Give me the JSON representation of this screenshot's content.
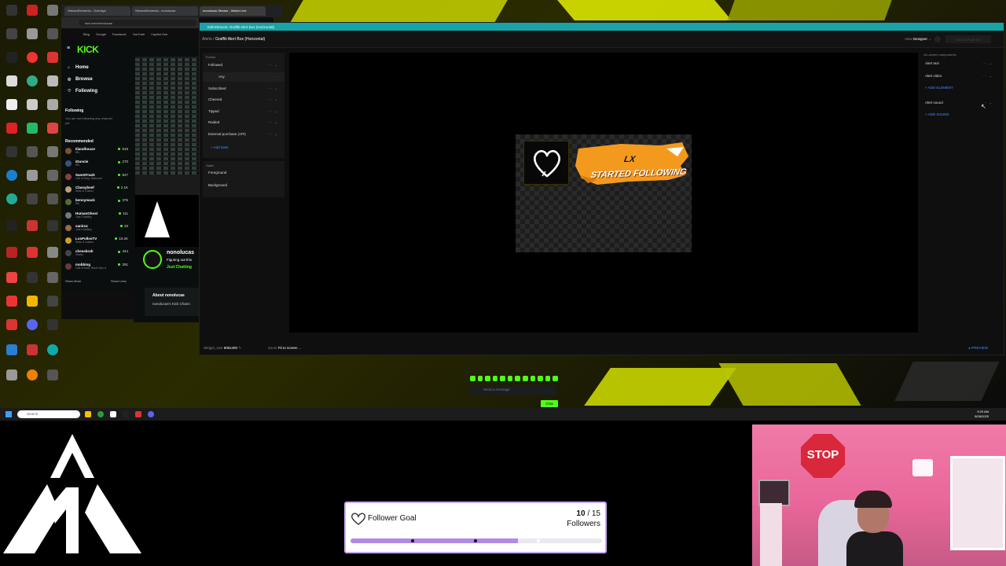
{
  "browser": {
    "tabs": [
      "StreamElements - Overlays",
      "StreamElements - nonolucas",
      "nonolucas Stream - Watch Live"
    ],
    "url": "kick.com/nonolucas",
    "bookmarks": [
      "Bing",
      "Google",
      "Facebook",
      "YouTube",
      "Capital One"
    ]
  },
  "kick": {
    "logo": "KICK",
    "nav": [
      {
        "icon": "home-icon",
        "label": "Home"
      },
      {
        "icon": "compass-icon",
        "label": "Browse"
      },
      {
        "icon": "heart-icon",
        "label": "Following"
      }
    ],
    "following_header": "Following",
    "not_following": "You are not following any channel yet.",
    "recommended_header": "Recommended",
    "channels": [
      {
        "name": "Iilandhouse",
        "sub": "IRL",
        "viewers": "519",
        "color": "#7a5230"
      },
      {
        "name": "iDuncle",
        "sub": "IRL",
        "viewers": "270",
        "color": "#335577"
      },
      {
        "name": "SamXFrank",
        "sub": "Call of Duty: Warzone",
        "viewers": "847",
        "color": "#8a4040"
      },
      {
        "name": "Classybeef",
        "sub": "Slots & Casino",
        "viewers": "2.1K",
        "color": "#b8a070"
      },
      {
        "name": "bennymack",
        "sub": "IRL",
        "viewers": "375",
        "color": "#556b2f"
      },
      {
        "name": "HumanGhost",
        "sub": "Just Chatting",
        "viewers": "111",
        "color": "#777777"
      },
      {
        "name": "xaniroz",
        "sub": "Just Chatting",
        "viewers": "33",
        "color": "#9a6a4a"
      },
      {
        "name": "LosPollosTV",
        "sub": "Slots & Casino",
        "viewers": "10.2K",
        "color": "#d0a020"
      },
      {
        "name": "chessbrah",
        "sub": "Chess",
        "viewers": "444",
        "color": "#444444"
      },
      {
        "name": "mobbing",
        "sub": "Call of Duty: Black Ops 6",
        "viewers": "291",
        "color": "#6a3a3a"
      }
    ],
    "show_more": "Show More",
    "show_less": "Show Less",
    "channel": {
      "name": "nonolucas",
      "status": "Figuring out this",
      "category": "Just Chatting",
      "about_title": "About nonolucas",
      "about_text": "nonolucas's Kick Chann"
    }
  },
  "se": {
    "window_title": "Edit Element: Graffiti Alert Box (Horizontal)",
    "breadcrumb_root": "Alerts",
    "breadcrumb_sep": "/",
    "breadcrumb_current": "Graffiti Alert Box (Horizontal)",
    "view_label": "View",
    "view_value": "Designer",
    "save_label": "SAVE & PUBLISH",
    "events_header": "Events",
    "events": [
      "Followed",
      "Any",
      "Subscribed",
      "Cheered",
      "Tipped",
      "Raided",
      "External purchase (API)"
    ],
    "event_controls": "··· ⌄",
    "add_state": "+ Add state",
    "static_header": "Static",
    "static_items": [
      "Foreground",
      "Background"
    ],
    "onscreen_header": "On-screen components",
    "components": [
      "Alert text",
      "Alert video"
    ],
    "add_element": "+ ADD ELEMENT",
    "sound_component": "Alert sound",
    "add_sound": "+ ADD SOUND",
    "widget_size_label": "Widget_size",
    "widget_size_value": "600x400",
    "zoom_label": "Zoom",
    "zoom_value": "Fit to screen",
    "preview_label": "▸ PREVIEW",
    "alert_name": "LX",
    "alert_message": "STARTED FOLLOWING"
  },
  "chat": {
    "placeholder": "Send a message",
    "button": "Chat"
  },
  "taskbar": {
    "search": "Search",
    "time": "5:29 AM",
    "date": "8/28/2025"
  },
  "goal": {
    "title": "Follower Goal",
    "current": "10",
    "separator": "/",
    "target": "15",
    "unit": "Followers",
    "progress": 0.6667,
    "fill_color": "#b28ae6",
    "border_color": "#c9a6f5"
  },
  "webcam": {
    "sign_text": "STOP"
  },
  "colors": {
    "kick_green": "#53fc18",
    "se_blue": "#4a8cff",
    "titlebar": "#18a3a7"
  }
}
